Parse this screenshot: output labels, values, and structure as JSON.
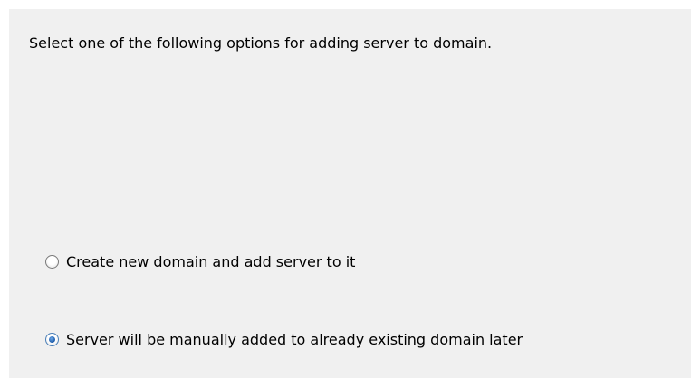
{
  "dialog": {
    "instruction": "Select one of the following options for adding server to domain.",
    "options": [
      {
        "label": "Create new domain and add server to it",
        "selected": false
      },
      {
        "label": "Server will be manually added to already existing domain later",
        "selected": true
      }
    ]
  }
}
